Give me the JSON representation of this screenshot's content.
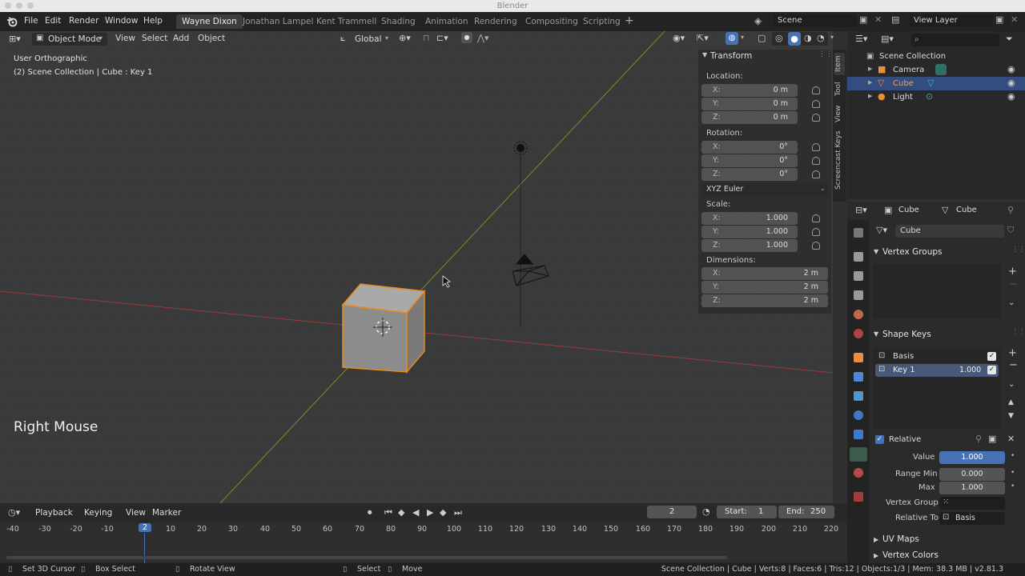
{
  "window": {
    "title": "Blender"
  },
  "menu": {
    "file": "File",
    "edit": "Edit",
    "render": "Render",
    "window": "Window",
    "help": "Help"
  },
  "workspaces": [
    "Wayne Dixon",
    "Jonathan Lampel",
    "Kent Trammell",
    "Shading",
    "Animation",
    "Rendering",
    "Compositing",
    "Scripting"
  ],
  "scene": {
    "name": "Scene",
    "view_layer": "View Layer"
  },
  "viewport": {
    "mode": "Object Mode",
    "menus": {
      "view": "View",
      "select": "Select",
      "add": "Add",
      "object": "Object"
    },
    "orientation": "Global",
    "view_name": "User Orthographic",
    "context": "(2) Scene Collection | Cube : Key 1",
    "key_overlay": "Right Mouse"
  },
  "transform_panel": {
    "title": "Transform",
    "location_label": "Location:",
    "location": {
      "x": "0 m",
      "y": "0 m",
      "z": "0 m"
    },
    "rotation_label": "Rotation:",
    "rotation": {
      "x": "0°",
      "y": "0°",
      "z": "0°"
    },
    "rotation_mode": "XYZ Euler",
    "scale_label": "Scale:",
    "scale": {
      "x": "1.000",
      "y": "1.000",
      "z": "1.000"
    },
    "dimensions_label": "Dimensions:",
    "dimensions": {
      "x": "2 m",
      "y": "2 m",
      "z": "2 m"
    },
    "axis": {
      "x": "X:",
      "y": "Y:",
      "z": "Z:"
    }
  },
  "sidebar_tabs": {
    "item": "Item",
    "tool": "Tool",
    "view": "View",
    "screencast": "Screencast Keys"
  },
  "outliner": {
    "root": "Scene Collection",
    "items": [
      {
        "label": "Camera"
      },
      {
        "label": "Cube"
      },
      {
        "label": "Light"
      }
    ]
  },
  "properties": {
    "object_name": "Cube",
    "mesh_name": "Cube",
    "data_field": "Cube",
    "vertex_groups": "Vertex Groups",
    "shape_keys": "Shape Keys",
    "keys": [
      {
        "label": "Basis",
        "value": ""
      },
      {
        "label": "Key 1",
        "value": "1.000"
      }
    ],
    "relative": "Relative",
    "value_label": "Value",
    "value": "1.000",
    "range_min_label": "Range Min",
    "range_min": "0.000",
    "max_label": "Max",
    "max": "1.000",
    "vertex_group_label": "Vertex Group",
    "relative_to_label": "Relative To",
    "relative_to": "Basis",
    "uv_maps": "UV Maps",
    "vertex_colors": "Vertex Colors"
  },
  "timeline": {
    "menus": {
      "playback": "Playback",
      "keying": "Keying",
      "view": "View",
      "marker": "Marker"
    },
    "current_frame": "2",
    "start_label": "Start:",
    "start": "1",
    "end_label": "End:",
    "end": "250",
    "ticks": [
      "-40",
      "-30",
      "-20",
      "-10",
      "2",
      "10",
      "20",
      "30",
      "40",
      "50",
      "60",
      "70",
      "80",
      "90",
      "100",
      "110",
      "120",
      "130",
      "140",
      "150",
      "160",
      "170",
      "180",
      "190",
      "200",
      "210",
      "220"
    ]
  },
  "status": {
    "cursor": "Set 3D Cursor",
    "box": "Box Select",
    "rotate": "Rotate View",
    "select": "Select",
    "move": "Move",
    "info": "Scene Collection | Cube | Verts:8 | Faces:6 | Tris:12 | Objects:1/3 | Mem: 38.3 MB | v2.81.3"
  },
  "colors": {
    "accent": "#4772b3",
    "selection": "#e88a1e",
    "x_axis": "#a23a3a",
    "y_axis": "#7c8f24"
  }
}
